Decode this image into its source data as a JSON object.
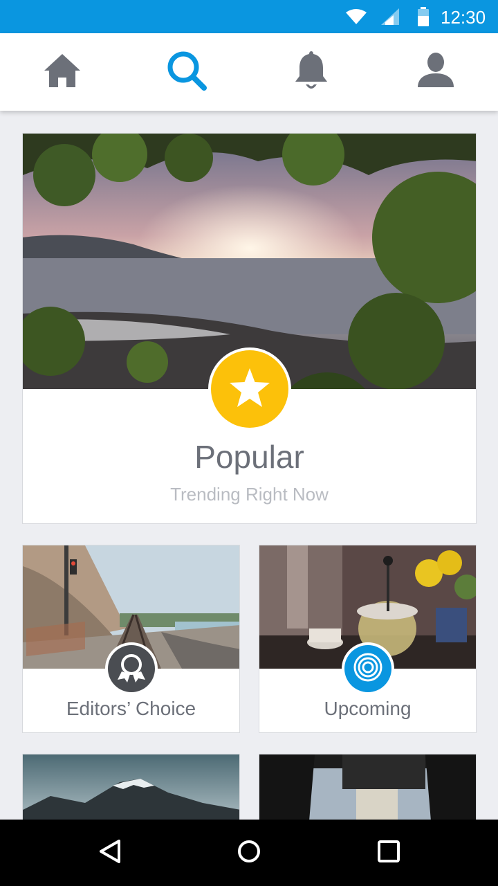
{
  "status_bar": {
    "time": "12:30",
    "icons": [
      "wifi-icon",
      "cell-signal-icon",
      "battery-icon"
    ],
    "background": "#0a96e0"
  },
  "top_nav": {
    "items": [
      {
        "icon": "home-icon",
        "active": false
      },
      {
        "icon": "search-icon",
        "active": true
      },
      {
        "icon": "bell-icon",
        "active": false
      },
      {
        "icon": "profile-icon",
        "active": false
      }
    ],
    "active_color": "#0a96e0",
    "inactive_color": "#6c7079"
  },
  "hero_card": {
    "title": "Popular",
    "subtitle": "Trending Right Now",
    "badge_icon": "star-icon",
    "badge_color": "#fcc10a"
  },
  "category_cards": [
    {
      "label": "Editors’ Choice",
      "badge_icon": "award-ribbon-icon",
      "badge_color": "#4a4d52"
    },
    {
      "label": "Upcoming",
      "badge_icon": "concentric-rings-icon",
      "badge_color": "#0a96e0"
    }
  ],
  "system_nav": {
    "buttons": [
      "back-icon",
      "home-circle-icon",
      "recents-square-icon"
    ]
  }
}
